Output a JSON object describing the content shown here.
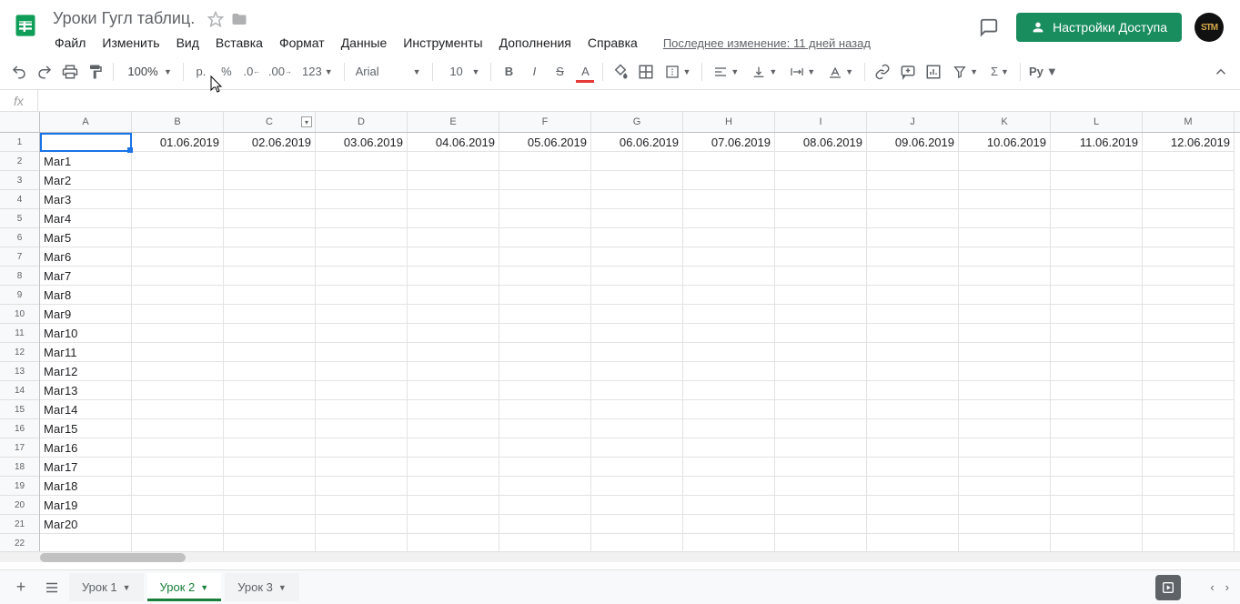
{
  "document": {
    "title": "Уроки Гугл таблиц.",
    "last_edit": "Последнее изменение: 11 дней назад"
  },
  "menu": {
    "file": "Файл",
    "edit": "Изменить",
    "view": "Вид",
    "insert": "Вставка",
    "format": "Формат",
    "data": "Данные",
    "tools": "Инструменты",
    "addons": "Дополнения",
    "help": "Справка"
  },
  "share_btn": "Настройки Доступа",
  "avatar": "STM",
  "toolbar": {
    "zoom": "100%",
    "currency": "р.",
    "percent": "%",
    "dec_less": ".0",
    "dec_more": ".00",
    "num_format": "123",
    "font": "Arial",
    "font_size": "10"
  },
  "formula": {
    "fx": "fx",
    "value": ""
  },
  "columns": [
    "A",
    "B",
    "C",
    "D",
    "E",
    "F",
    "G",
    "H",
    "I",
    "J",
    "K",
    "L",
    "M"
  ],
  "row_numbers": [
    "1",
    "2",
    "3",
    "4",
    "5",
    "6",
    "7",
    "8",
    "9",
    "10",
    "11",
    "12",
    "13",
    "14",
    "15",
    "16",
    "17",
    "18",
    "19",
    "20",
    "21",
    "22"
  ],
  "row1": [
    "",
    "01.06.2019",
    "02.06.2019",
    "03.06.2019",
    "04.06.2019",
    "05.06.2019",
    "06.06.2019",
    "07.06.2019",
    "08.06.2019",
    "09.06.2019",
    "10.06.2019",
    "11.06.2019",
    "12.06.2019"
  ],
  "colA": [
    "",
    "Маг1",
    "Маг2",
    "Маг3",
    "Маг4",
    "Маг5",
    "Маг6",
    "Маг7",
    "Маг8",
    "Маг9",
    "Маг10",
    "Маг11",
    "Маг12",
    "Маг13",
    "Маг14",
    "Маг15",
    "Маг16",
    "Маг17",
    "Маг18",
    "Маг19",
    "Маг20",
    ""
  ],
  "tabs": {
    "tab1": "Урок 1",
    "tab2": "Урок 2",
    "tab3": "Урок 3"
  }
}
